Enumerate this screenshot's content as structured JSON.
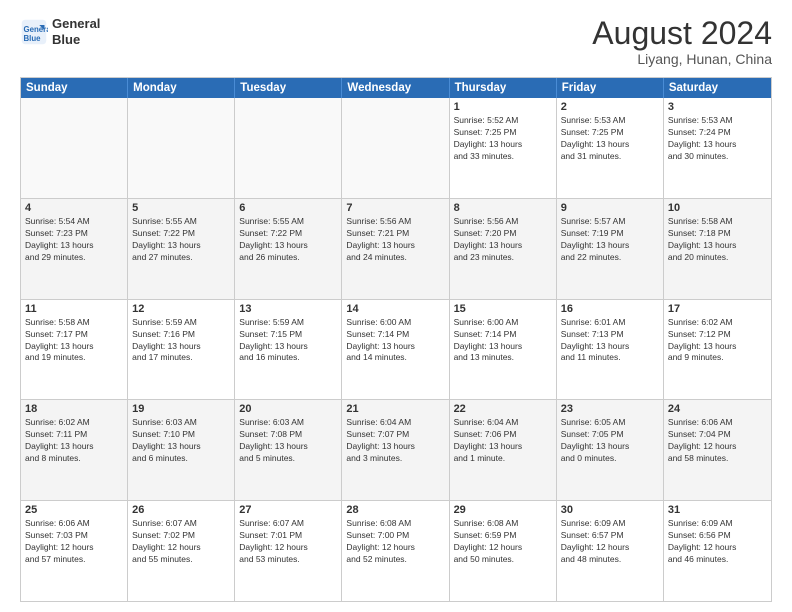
{
  "header": {
    "logo_line1": "General",
    "logo_line2": "Blue",
    "month_year": "August 2024",
    "location": "Liyang, Hunan, China"
  },
  "weekdays": [
    "Sunday",
    "Monday",
    "Tuesday",
    "Wednesday",
    "Thursday",
    "Friday",
    "Saturday"
  ],
  "rows": [
    [
      {
        "day": "",
        "info": ""
      },
      {
        "day": "",
        "info": ""
      },
      {
        "day": "",
        "info": ""
      },
      {
        "day": "",
        "info": ""
      },
      {
        "day": "1",
        "info": "Sunrise: 5:52 AM\nSunset: 7:25 PM\nDaylight: 13 hours\nand 33 minutes."
      },
      {
        "day": "2",
        "info": "Sunrise: 5:53 AM\nSunset: 7:25 PM\nDaylight: 13 hours\nand 31 minutes."
      },
      {
        "day": "3",
        "info": "Sunrise: 5:53 AM\nSunset: 7:24 PM\nDaylight: 13 hours\nand 30 minutes."
      }
    ],
    [
      {
        "day": "4",
        "info": "Sunrise: 5:54 AM\nSunset: 7:23 PM\nDaylight: 13 hours\nand 29 minutes."
      },
      {
        "day": "5",
        "info": "Sunrise: 5:55 AM\nSunset: 7:22 PM\nDaylight: 13 hours\nand 27 minutes."
      },
      {
        "day": "6",
        "info": "Sunrise: 5:55 AM\nSunset: 7:22 PM\nDaylight: 13 hours\nand 26 minutes."
      },
      {
        "day": "7",
        "info": "Sunrise: 5:56 AM\nSunset: 7:21 PM\nDaylight: 13 hours\nand 24 minutes."
      },
      {
        "day": "8",
        "info": "Sunrise: 5:56 AM\nSunset: 7:20 PM\nDaylight: 13 hours\nand 23 minutes."
      },
      {
        "day": "9",
        "info": "Sunrise: 5:57 AM\nSunset: 7:19 PM\nDaylight: 13 hours\nand 22 minutes."
      },
      {
        "day": "10",
        "info": "Sunrise: 5:58 AM\nSunset: 7:18 PM\nDaylight: 13 hours\nand 20 minutes."
      }
    ],
    [
      {
        "day": "11",
        "info": "Sunrise: 5:58 AM\nSunset: 7:17 PM\nDaylight: 13 hours\nand 19 minutes."
      },
      {
        "day": "12",
        "info": "Sunrise: 5:59 AM\nSunset: 7:16 PM\nDaylight: 13 hours\nand 17 minutes."
      },
      {
        "day": "13",
        "info": "Sunrise: 5:59 AM\nSunset: 7:15 PM\nDaylight: 13 hours\nand 16 minutes."
      },
      {
        "day": "14",
        "info": "Sunrise: 6:00 AM\nSunset: 7:14 PM\nDaylight: 13 hours\nand 14 minutes."
      },
      {
        "day": "15",
        "info": "Sunrise: 6:00 AM\nSunset: 7:14 PM\nDaylight: 13 hours\nand 13 minutes."
      },
      {
        "day": "16",
        "info": "Sunrise: 6:01 AM\nSunset: 7:13 PM\nDaylight: 13 hours\nand 11 minutes."
      },
      {
        "day": "17",
        "info": "Sunrise: 6:02 AM\nSunset: 7:12 PM\nDaylight: 13 hours\nand 9 minutes."
      }
    ],
    [
      {
        "day": "18",
        "info": "Sunrise: 6:02 AM\nSunset: 7:11 PM\nDaylight: 13 hours\nand 8 minutes."
      },
      {
        "day": "19",
        "info": "Sunrise: 6:03 AM\nSunset: 7:10 PM\nDaylight: 13 hours\nand 6 minutes."
      },
      {
        "day": "20",
        "info": "Sunrise: 6:03 AM\nSunset: 7:08 PM\nDaylight: 13 hours\nand 5 minutes."
      },
      {
        "day": "21",
        "info": "Sunrise: 6:04 AM\nSunset: 7:07 PM\nDaylight: 13 hours\nand 3 minutes."
      },
      {
        "day": "22",
        "info": "Sunrise: 6:04 AM\nSunset: 7:06 PM\nDaylight: 13 hours\nand 1 minute."
      },
      {
        "day": "23",
        "info": "Sunrise: 6:05 AM\nSunset: 7:05 PM\nDaylight: 13 hours\nand 0 minutes."
      },
      {
        "day": "24",
        "info": "Sunrise: 6:06 AM\nSunset: 7:04 PM\nDaylight: 12 hours\nand 58 minutes."
      }
    ],
    [
      {
        "day": "25",
        "info": "Sunrise: 6:06 AM\nSunset: 7:03 PM\nDaylight: 12 hours\nand 57 minutes."
      },
      {
        "day": "26",
        "info": "Sunrise: 6:07 AM\nSunset: 7:02 PM\nDaylight: 12 hours\nand 55 minutes."
      },
      {
        "day": "27",
        "info": "Sunrise: 6:07 AM\nSunset: 7:01 PM\nDaylight: 12 hours\nand 53 minutes."
      },
      {
        "day": "28",
        "info": "Sunrise: 6:08 AM\nSunset: 7:00 PM\nDaylight: 12 hours\nand 52 minutes."
      },
      {
        "day": "29",
        "info": "Sunrise: 6:08 AM\nSunset: 6:59 PM\nDaylight: 12 hours\nand 50 minutes."
      },
      {
        "day": "30",
        "info": "Sunrise: 6:09 AM\nSunset: 6:57 PM\nDaylight: 12 hours\nand 48 minutes."
      },
      {
        "day": "31",
        "info": "Sunrise: 6:09 AM\nSunset: 6:56 PM\nDaylight: 12 hours\nand 46 minutes."
      }
    ]
  ]
}
